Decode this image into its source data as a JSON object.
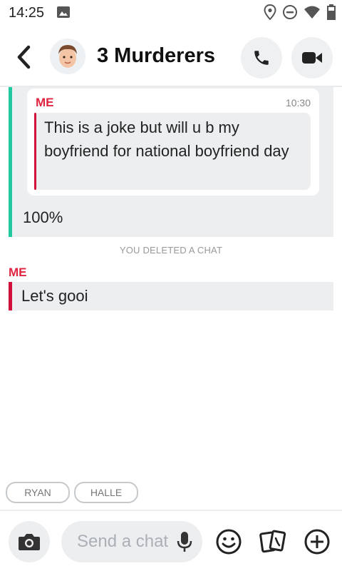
{
  "status_bar": {
    "time": "14:25"
  },
  "header": {
    "title": "3 Murderers"
  },
  "quoted_message": {
    "sender": "ME",
    "time": "10:30",
    "text": "This is a joke but will u b my boyfriend for national boyfriend day",
    "reply": "100%"
  },
  "system_message": "YOU DELETED A CHAT",
  "message": {
    "sender": "ME",
    "text": "Let's gooi"
  },
  "chips": [
    "RYAN",
    "HALLE"
  ],
  "composer": {
    "placeholder": "Send a chat"
  },
  "colors": {
    "accent_red": "#e0243f",
    "accent_teal": "#21c9a1",
    "bubble_gray": "#eceef0"
  }
}
